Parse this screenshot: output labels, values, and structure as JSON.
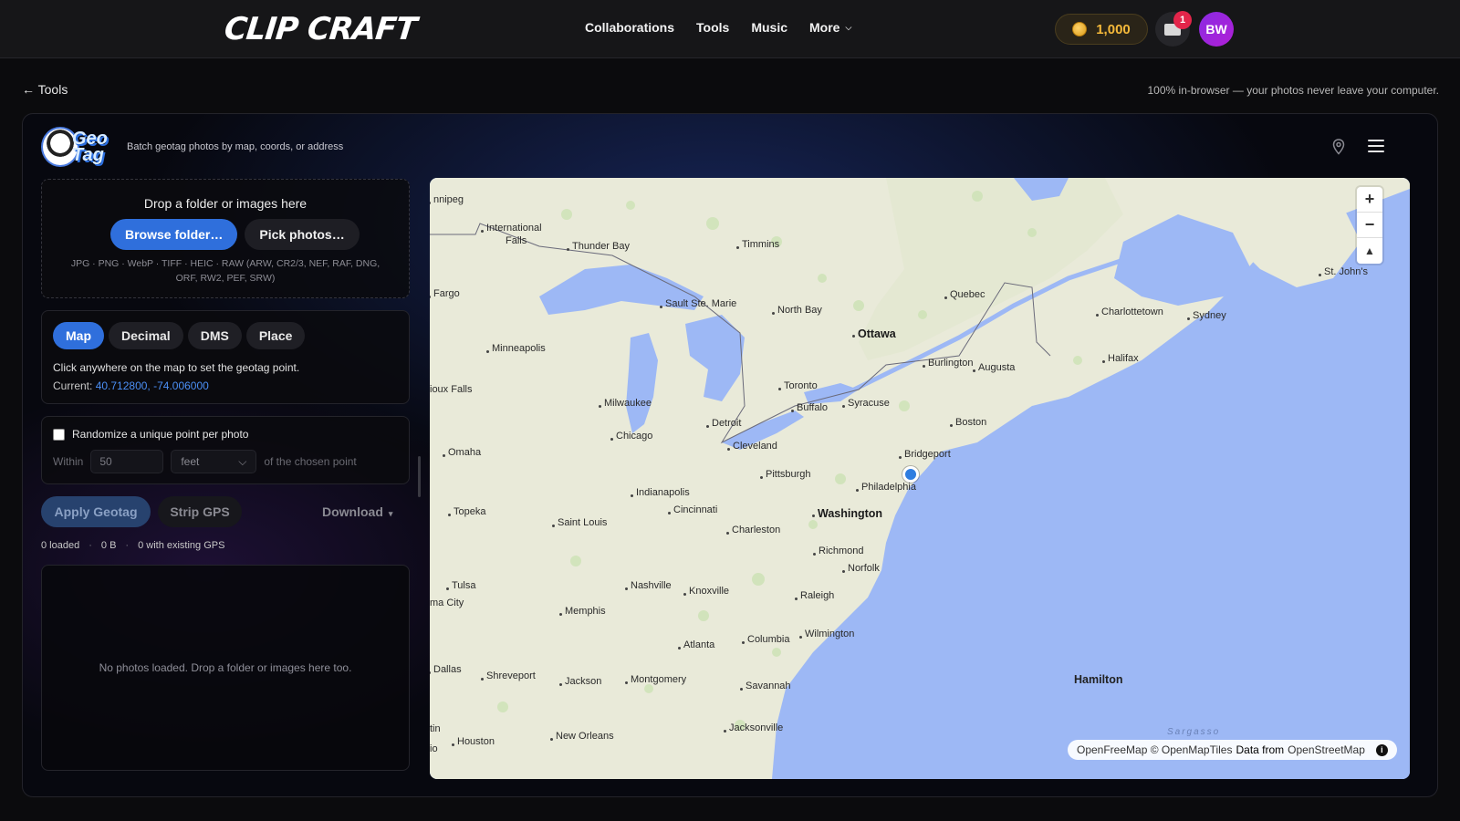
{
  "topbar": {
    "logo": "CLIP CRAFT",
    "nav": [
      "Collaborations",
      "Tools",
      "Music",
      "More"
    ],
    "coins": "1,000",
    "notification_count": "1",
    "avatar_initials": "BW"
  },
  "subheader": {
    "back_label": "← Tools",
    "privacy_note": "100% in-browser — your photos never leave your computer."
  },
  "app": {
    "logo_text": "Geo Tag",
    "subtitle": "Batch geotag photos by map, coords, or address"
  },
  "dropzone": {
    "title": "Drop a folder or images here",
    "browse_label": "Browse folder…",
    "pick_label": "Pick photos…",
    "formats": "JPG · PNG · WebP · TIFF · HEIC · RAW (ARW, CR2/3, NEF, RAF, DNG, ORF, RW2, PEF, SRW)"
  },
  "mode": {
    "tabs": [
      {
        "label": "Map",
        "active": true
      },
      {
        "label": "Decimal",
        "active": false
      },
      {
        "label": "DMS",
        "active": false
      },
      {
        "label": "Place",
        "active": false
      }
    ],
    "hint": "Click anywhere on the map to set the geotag point.",
    "current_label": "Current:",
    "current_value": "40.712800, -74.006000"
  },
  "randomize": {
    "label": "Randomize a unique point per photo",
    "checked": false,
    "within_label": "Within",
    "distance_value": "50",
    "unit": "feet",
    "suffix": "of the chosen point"
  },
  "actions": {
    "apply_label": "Apply Geotag",
    "strip_label": "Strip GPS",
    "download_label": "Download"
  },
  "stats": {
    "loaded": "0 loaded",
    "size": "0 B",
    "existing_gps": "0 with existing GPS"
  },
  "photos": {
    "empty_text": "No photos loaded. Drop a folder or images here too."
  },
  "map": {
    "zoom_in": "+",
    "zoom_out": "−",
    "compass": "▲",
    "sea_label": "Sargasso",
    "attribution_a": "OpenFreeMap © OpenMapTiles",
    "attribution_b": "Data from",
    "attribution_c": "OpenStreetMap",
    "info_glyph": "i",
    "cities": {
      "winnipeg": "nnipeg",
      "intl_falls_1": "International",
      "intl_falls_2": "Falls",
      "thunder_bay": "Thunder Bay",
      "timmins": "Timmins",
      "st_johns": "St. John's",
      "fargo": "Fargo",
      "sault": "Sault Ste. Marie",
      "quebec": "Quebec",
      "north_bay": "North Bay",
      "charlottetown": "Charlottetown",
      "sydney": "Sydney",
      "minneapolis": "Minneapolis",
      "ottawa": "Ottawa",
      "burlington": "Burlington",
      "augusta": "Augusta",
      "halifax": "Halifax",
      "sioux_falls": "ioux Falls",
      "milwaukee": "Milwaukee",
      "toronto": "Toronto",
      "syracuse": "Syracuse",
      "buffalo": "Buffalo",
      "detroit": "Detroit",
      "boston": "Boston",
      "omaha": "Omaha",
      "chicago": "Chicago",
      "cleveland": "Cleveland",
      "bridgeport": "Bridgeport",
      "pittsburgh": "Pittsburgh",
      "philadelphia": "Philadelphia",
      "indianapolis": "Indianapolis",
      "topeka": "Topeka",
      "cincinnati": "Cincinnati",
      "washington": "Washington",
      "saint_louis": "Saint Louis",
      "charleston": "Charleston",
      "richmond": "Richmond",
      "norfolk": "Norfolk",
      "tulsa": "Tulsa",
      "nashville": "Nashville",
      "knoxville": "Knoxville",
      "okc": "ma City",
      "raleigh": "Raleigh",
      "memphis": "Memphis",
      "wilmington": "Wilmington",
      "columbia": "Columbia",
      "atlanta": "Atlanta",
      "dallas": "Dallas",
      "shreveport": "Shreveport",
      "jackson": "Jackson",
      "montgomery": "Montgomery",
      "savannah": "Savannah",
      "hamilton": "Hamilton",
      "austin": "tin",
      "houston": "Houston",
      "new_orleans": "New Orleans",
      "jacksonville": "Jacksonville",
      "san_antonio": "io"
    }
  }
}
